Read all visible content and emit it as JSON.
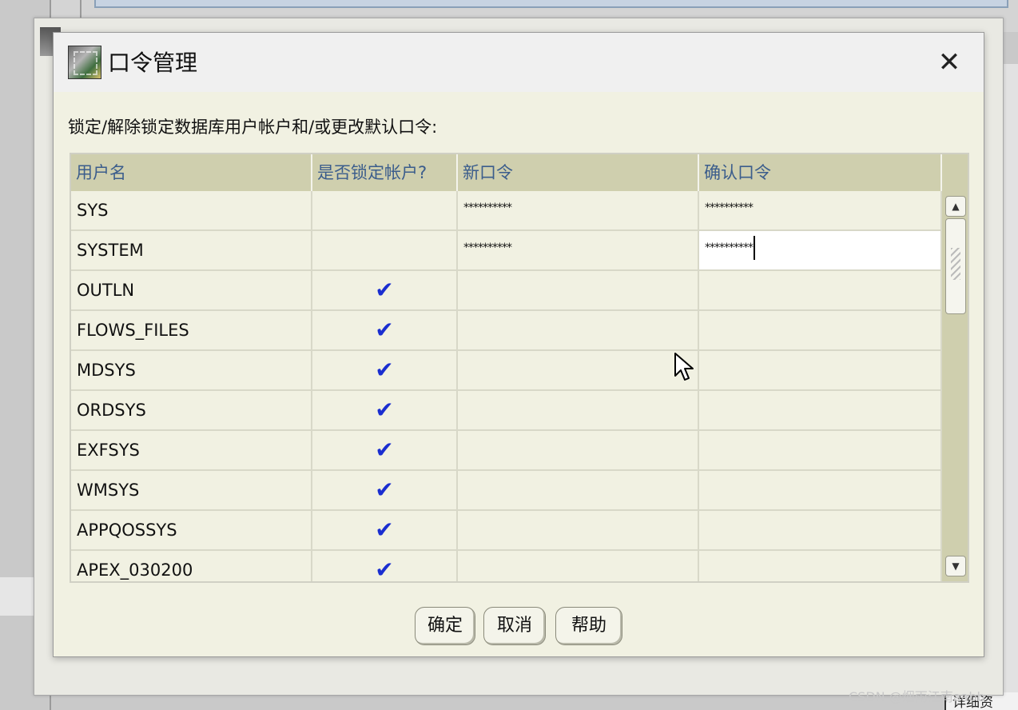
{
  "dialog": {
    "title": "口令管理",
    "close_glyph": "✕",
    "instruction": "锁定/解除锁定数据库用户帐户和/或更改默认口令:"
  },
  "table": {
    "headers": [
      "用户名",
      "是否锁定帐户?",
      "新口令",
      "确认口令"
    ],
    "rows": [
      {
        "user": "SYS",
        "locked": "",
        "new_pw": "**********",
        "confirm_pw": "**********"
      },
      {
        "user": "SYSTEM",
        "locked": "",
        "new_pw": "**********",
        "confirm_pw": "**********"
      },
      {
        "user": "OUTLN",
        "locked": "✔",
        "new_pw": "",
        "confirm_pw": ""
      },
      {
        "user": "FLOWS_FILES",
        "locked": "✔",
        "new_pw": "",
        "confirm_pw": ""
      },
      {
        "user": "MDSYS",
        "locked": "✔",
        "new_pw": "",
        "confirm_pw": ""
      },
      {
        "user": "ORDSYS",
        "locked": "✔",
        "new_pw": "",
        "confirm_pw": ""
      },
      {
        "user": "EXFSYS",
        "locked": "✔",
        "new_pw": "",
        "confirm_pw": ""
      },
      {
        "user": "WMSYS",
        "locked": "✔",
        "new_pw": "",
        "confirm_pw": ""
      },
      {
        "user": "APPQOSSYS",
        "locked": "✔",
        "new_pw": "",
        "confirm_pw": ""
      },
      {
        "user": "APEX_030200",
        "locked": "✔",
        "new_pw": "",
        "confirm_pw": ""
      }
    ]
  },
  "buttons": {
    "ok": "确定",
    "cancel": "取消",
    "help": "帮助"
  },
  "background": {
    "partial_text": "详细资"
  },
  "watermark": "CSDN @烟雨江南aabb",
  "colors": {
    "dialog_bg": "#f1f1e2",
    "header_bg": "#cfcfae",
    "header_text": "#3b5d8c",
    "check": "#1a2ed0"
  }
}
